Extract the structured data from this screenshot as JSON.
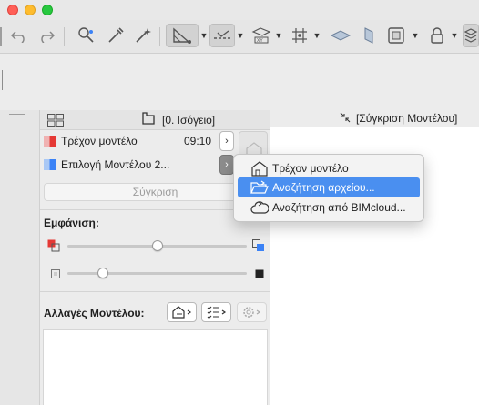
{
  "colors": {
    "accent": "#4a8ff0",
    "window_close": "#ff5f57",
    "window_minimize": "#febc2e",
    "window_zoom": "#28c840",
    "current_model_marker": "#e53935",
    "selected_model_marker": "#3b82f6"
  },
  "toolbar": {
    "icons": [
      "undo-icon",
      "redo-icon",
      "eyedropper-icon",
      "syringe-icon",
      "magic-wand-icon",
      "snap-guide-icon",
      "guide-line-icon",
      "coordinates-icon",
      "grid-snap-icon",
      "plane-icon",
      "section-icon",
      "display-frame-icon",
      "lock-icon",
      "layers-icon"
    ]
  },
  "palette": {
    "story_label": "[0. Ισόγειο]",
    "current_model_label": "Τρέχον μοντέλο",
    "current_model_time": "09:10",
    "selected_model_label": "Επιλογή Μοντέλου 2...",
    "compare_button": "Σύγκριση",
    "display_heading": "Εμφάνιση:",
    "changes_heading": "Αλλαγές Μοντέλου:",
    "slider1_value_percent": 50,
    "slider2_value_percent": 20
  },
  "canvas": {
    "compare_label": "[Σύγκριση Μοντέλου]"
  },
  "menu": {
    "items": [
      {
        "label": "Τρέχον μοντέλο",
        "icon": "house-icon",
        "selected": false
      },
      {
        "label": "Αναζήτηση αρχείου...",
        "icon": "folder-open-icon",
        "selected": true
      },
      {
        "label": "Αναζήτηση από BIMcloud...",
        "icon": "cloud-icon",
        "selected": false
      }
    ]
  }
}
